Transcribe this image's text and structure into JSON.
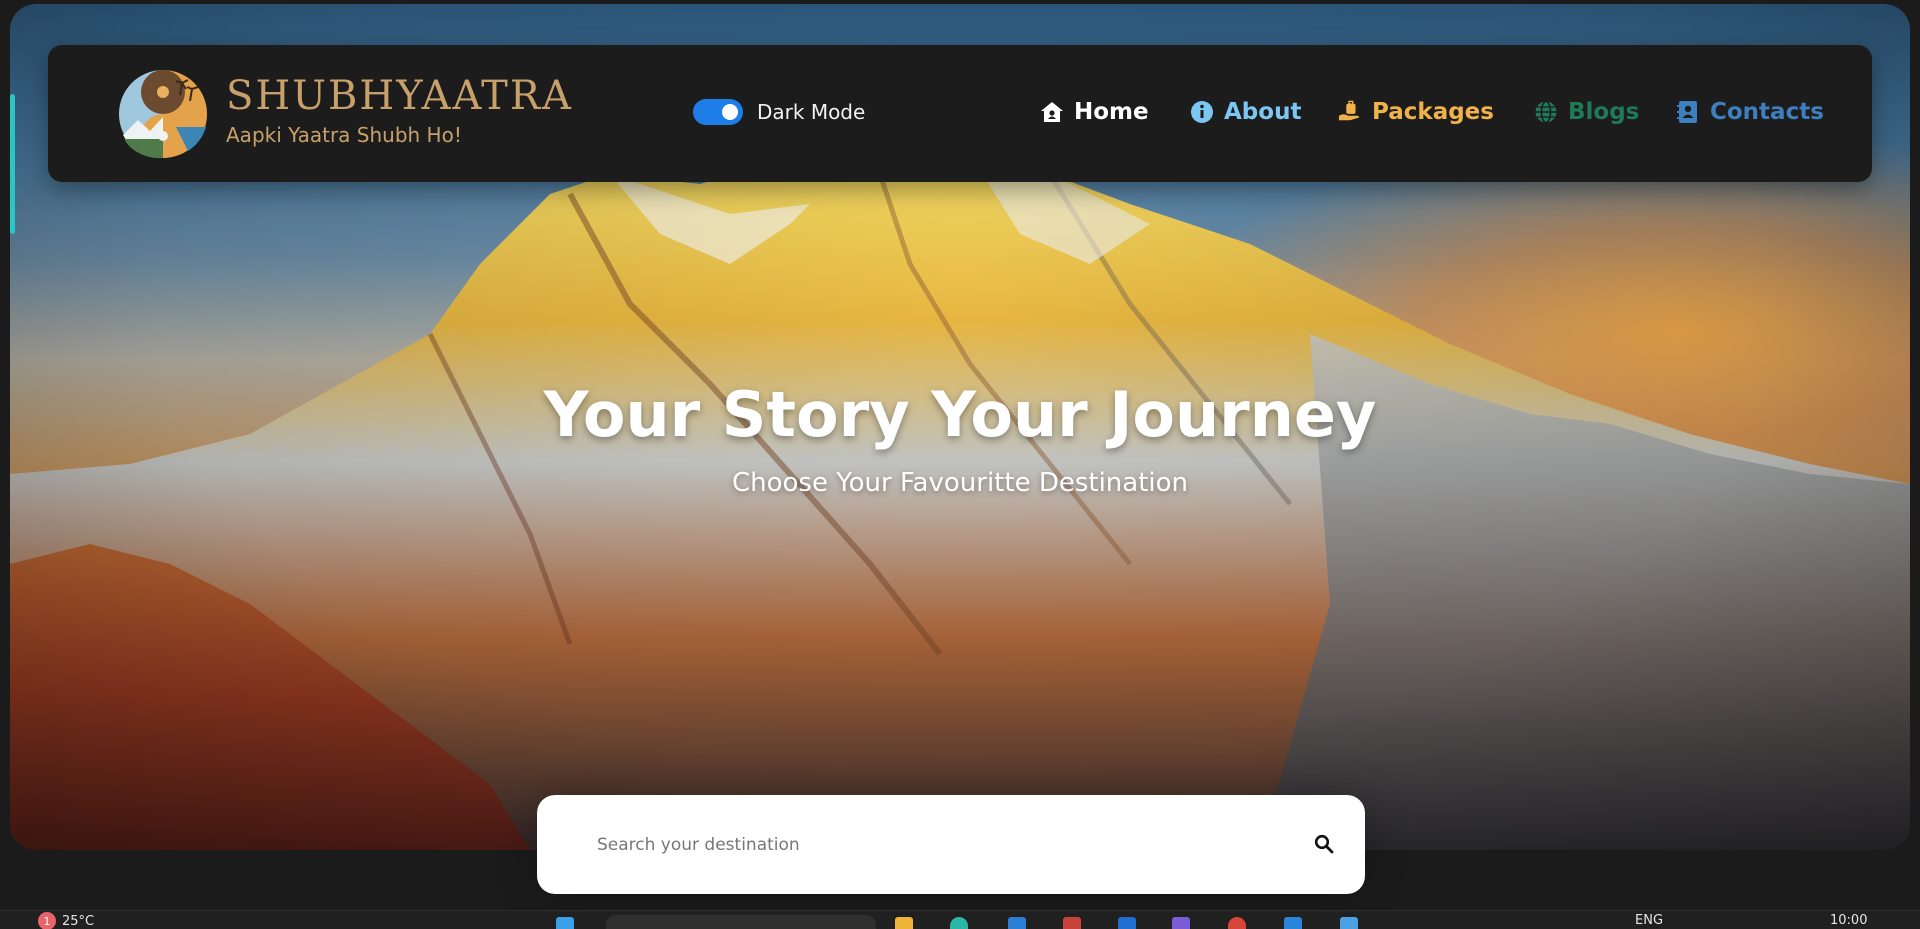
{
  "brand": {
    "name": "SHUBHYAATRA",
    "tagline": "Aapki Yaatra Shubh Ho!",
    "color": "#c8a06a"
  },
  "theme_toggle": {
    "label": "Dark Mode",
    "enabled": true,
    "accent": "#1e7de6"
  },
  "nav": {
    "items": [
      {
        "label": "Home",
        "icon": "house-icon",
        "color": "#ffffff"
      },
      {
        "label": "About",
        "icon": "info-circle-icon",
        "color": "#7cc6f2"
      },
      {
        "label": "Packages",
        "icon": "luggage-hand-icon",
        "color": "#f0b24a"
      },
      {
        "label": "Blogs",
        "icon": "globe-icon",
        "color": "#1f7a5a"
      },
      {
        "label": "Contacts",
        "icon": "address-book-icon",
        "color": "#3d7fbf"
      }
    ]
  },
  "hero": {
    "title": "Your Story Your Journey",
    "subtitle": "Choose Your Favouritte Destination"
  },
  "search": {
    "placeholder": "Search your destination",
    "value": "",
    "button_icon": "search-icon"
  },
  "taskbar": {
    "weather_badge": "1",
    "temperature": "25°C",
    "language": "ENG",
    "time": "10:00"
  }
}
